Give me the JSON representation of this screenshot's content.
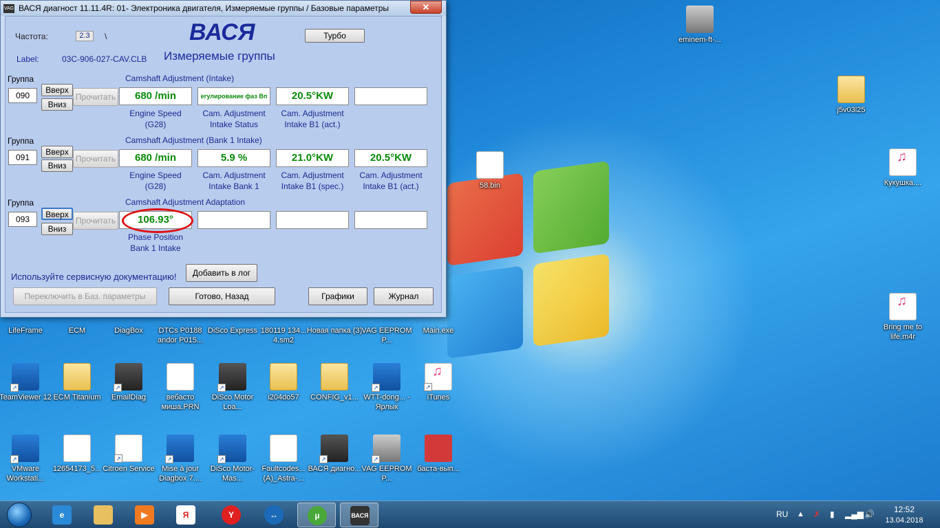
{
  "window": {
    "title": "ВАСЯ диагност 11.11.4R: 01- Электроника двигателя,  Измеряемые группы / Базовые параметры",
    "brand": "ВАСЯ",
    "subtitle": "Измеряемые группы",
    "frequency_label": "Частота:",
    "frequency_value": "2.3",
    "frequency_suffix": "\\",
    "label_label": "Label:",
    "label_value": "03C-906-027-CAV.CLB",
    "turbo_button": "Турбо",
    "groups": [
      {
        "group_label": "Группа",
        "number": "090",
        "up": "Вверх",
        "down": "Вниз",
        "read": "Прочитать",
        "heading": "Camshaft Adjustment (Intake)",
        "values": [
          "680 /min",
          "егулирование фаз Вп",
          "20.5°KW",
          ""
        ],
        "captions": [
          [
            "Engine Speed",
            "(G28)"
          ],
          [
            "Cam. Adjustment",
            "Intake Status"
          ],
          [
            "Cam. Adjustment",
            "Intake B1 (act.)"
          ],
          [
            "",
            ""
          ]
        ]
      },
      {
        "group_label": "Группа",
        "number": "091",
        "up": "Вверх",
        "down": "Вниз",
        "read": "Прочитать",
        "heading": "Camshaft Adjustment (Bank 1 Intake)",
        "values": [
          "680 /min",
          "5.9 %",
          "21.0°KW",
          "20.5°KW"
        ],
        "captions": [
          [
            "Engine Speed",
            "(G28)"
          ],
          [
            "Cam. Adjustment",
            "Intake Bank 1"
          ],
          [
            "Cam. Adjustment",
            "Intake B1 (spec.)"
          ],
          [
            "Cam. Adjustment",
            "Intake B1 (act.)"
          ]
        ]
      },
      {
        "group_label": "Группа",
        "number": "093",
        "up": "Вверх",
        "down": "Вниз",
        "read": "Прочитать",
        "heading": "Camshaft Adjustment Adaptation",
        "values": [
          "106.93°",
          "",
          "",
          ""
        ],
        "captions": [
          [
            "Phase Position",
            "Bank 1 Intake"
          ],
          [
            "",
            ""
          ],
          [
            "",
            ""
          ],
          [
            "",
            ""
          ]
        ]
      }
    ],
    "service_hint": "Используйте сервисную документацию!",
    "add_log_button": "Добавить в лог",
    "switch_button": "Переключить в Баз. параметры",
    "done_button": "Готово, Назад",
    "graphs_button": "Графики",
    "journal_button": "Журнал"
  },
  "desktop": {
    "right_icons": [
      {
        "label": "eminem-ft-...",
        "kind": "photo"
      },
      {
        "label": "j5v03l25",
        "kind": "folder"
      },
      {
        "label": "Кукушка....",
        "kind": "music"
      },
      {
        "label": "Bring me to life.m4r",
        "kind": "music"
      },
      {
        "label": "58.bin",
        "kind": "doc"
      }
    ],
    "row1": [
      "LifeFrame",
      "ECM",
      "DiagBox",
      "DTCs P0188 andor P015...",
      "DiSco Express",
      "180119 134... 4.sm2",
      "Новая папка (3)",
      "VAG EEPROM P...",
      "Main.exe"
    ],
    "row2": [
      "TeamViewer 12",
      "ECM Titanium",
      "EmailDiag",
      "вебасто миша.PRN",
      "DiSco Motor Loa...",
      "i204do57",
      "CONFIG_v1...",
      "WTT-dong... - Ярлык",
      "iTunes"
    ],
    "row3": [
      "VMware Workstati...",
      "12654173_5...",
      "Citroen Service",
      "Mise à jour Diagbox 7....",
      "DiSco Motor-Mas...",
      "Faultcodes... (A)_Astra-...",
      "ВАСЯ диагно...",
      "VAG EEPROM P...",
      "баста-вып..."
    ]
  },
  "taskbar": {
    "apps": [
      "ie",
      "explorer",
      "media",
      "yandex-browser",
      "yandex",
      "teamviewer",
      "utorrent",
      "vasya"
    ],
    "active_app": "ВАСЯ",
    "language": "RU",
    "time": "12:52",
    "date": "13.04.2018"
  },
  "colors": {
    "value_green": "#0a8a0a",
    "label_blue": "#1a2a90",
    "highlight_red": "#e01010"
  }
}
